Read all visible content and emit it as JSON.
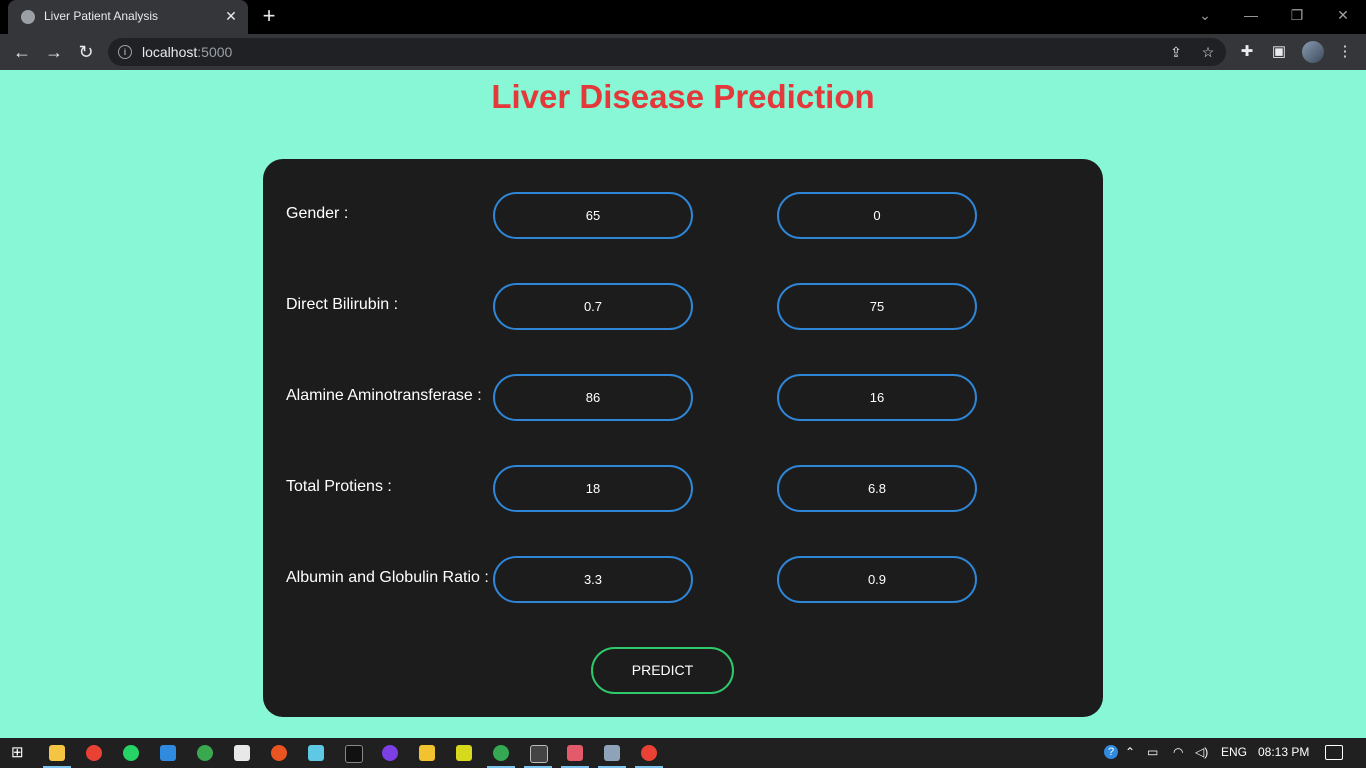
{
  "browser": {
    "tab_title": "Liver Patient Analysis",
    "url_host": "localhost",
    "url_port": ":5000"
  },
  "page": {
    "title": "Liver Disease Prediction",
    "rows": [
      {
        "label": "Gender :",
        "left_value": "65",
        "right_value": "0"
      },
      {
        "label": "Direct Bilirubin :",
        "left_value": "0.7",
        "right_value": "75"
      },
      {
        "label": "Alamine Aminotransferase :",
        "left_value": "86",
        "right_value": "16"
      },
      {
        "label": "Total Protiens :",
        "left_value": "18",
        "right_value": "6.8"
      },
      {
        "label": "Albumin and Globulin Ratio :",
        "left_value": "3.3",
        "right_value": "0.9"
      }
    ],
    "predict_label": "PREDICT"
  },
  "taskbar": {
    "language": "ENG",
    "time": "08:13 PM"
  },
  "colors": {
    "page_bg": "#87f7d6",
    "title": "#e4383a",
    "card_bg": "#1c1c1c",
    "field_border": "#2f85d6",
    "predict_border": "#2fc86a"
  }
}
